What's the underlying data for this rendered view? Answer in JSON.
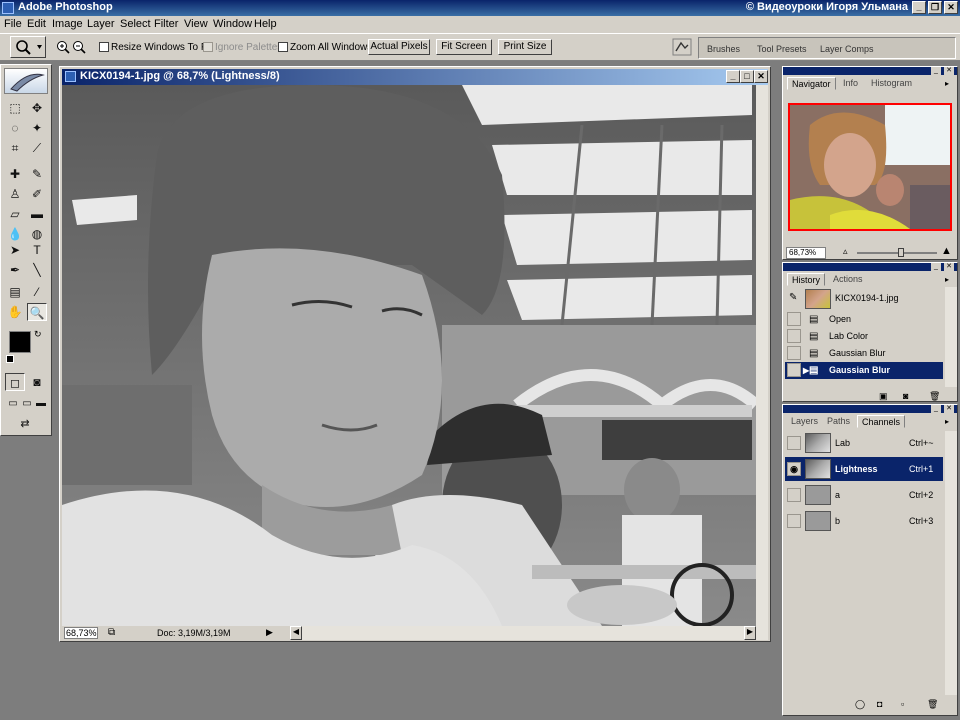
{
  "app": {
    "title": "Adobe Photoshop",
    "credit": "© Видеоуроки Игоря Ульмана"
  },
  "menu": [
    "File",
    "Edit",
    "Image",
    "Layer",
    "Select",
    "Filter",
    "View",
    "Window",
    "Help"
  ],
  "options": {
    "resize_windows_label": "Resize Windows To Fit",
    "ignore_palettes_label": "Ignore Palettes",
    "zoom_all_windows_label": "Zoom All Windows",
    "actual_pixels": "Actual Pixels",
    "fit_screen": "Fit Screen",
    "print_size": "Print Size",
    "well_tabs": [
      "Brushes",
      "Tool Presets",
      "Layer Comps"
    ]
  },
  "document": {
    "title": "KICX0194-1.jpg @ 68,7% (Lightness/8)",
    "zoom": "68,73%",
    "doc_info": "Doc: 3,19M/3,19M"
  },
  "navigator": {
    "tabs": [
      "Navigator",
      "Info",
      "Histogram"
    ],
    "zoom": "68,73%",
    "zoom_level": 0.55
  },
  "history": {
    "tabs": [
      "History",
      "Actions"
    ],
    "snapshot": "KICX0194-1.jpg",
    "items": [
      "Open",
      "Lab Color",
      "Gaussian Blur",
      "Gaussian Blur"
    ],
    "selected_index": 3
  },
  "channels": {
    "tabs": [
      "Layers",
      "Paths",
      "Channels"
    ],
    "items": [
      {
        "name": "Lab",
        "shortcut": "Ctrl+~"
      },
      {
        "name": "Lightness",
        "shortcut": "Ctrl+1"
      },
      {
        "name": "a",
        "shortcut": "Ctrl+2"
      },
      {
        "name": "b",
        "shortcut": "Ctrl+3"
      }
    ],
    "selected_index": 1
  },
  "colors": {
    "titlebar": "#0a246a",
    "chrome": "#d4d0c8",
    "foreground": "#000000",
    "background": "#ffffff",
    "navigator_frame": "#ff0000"
  }
}
